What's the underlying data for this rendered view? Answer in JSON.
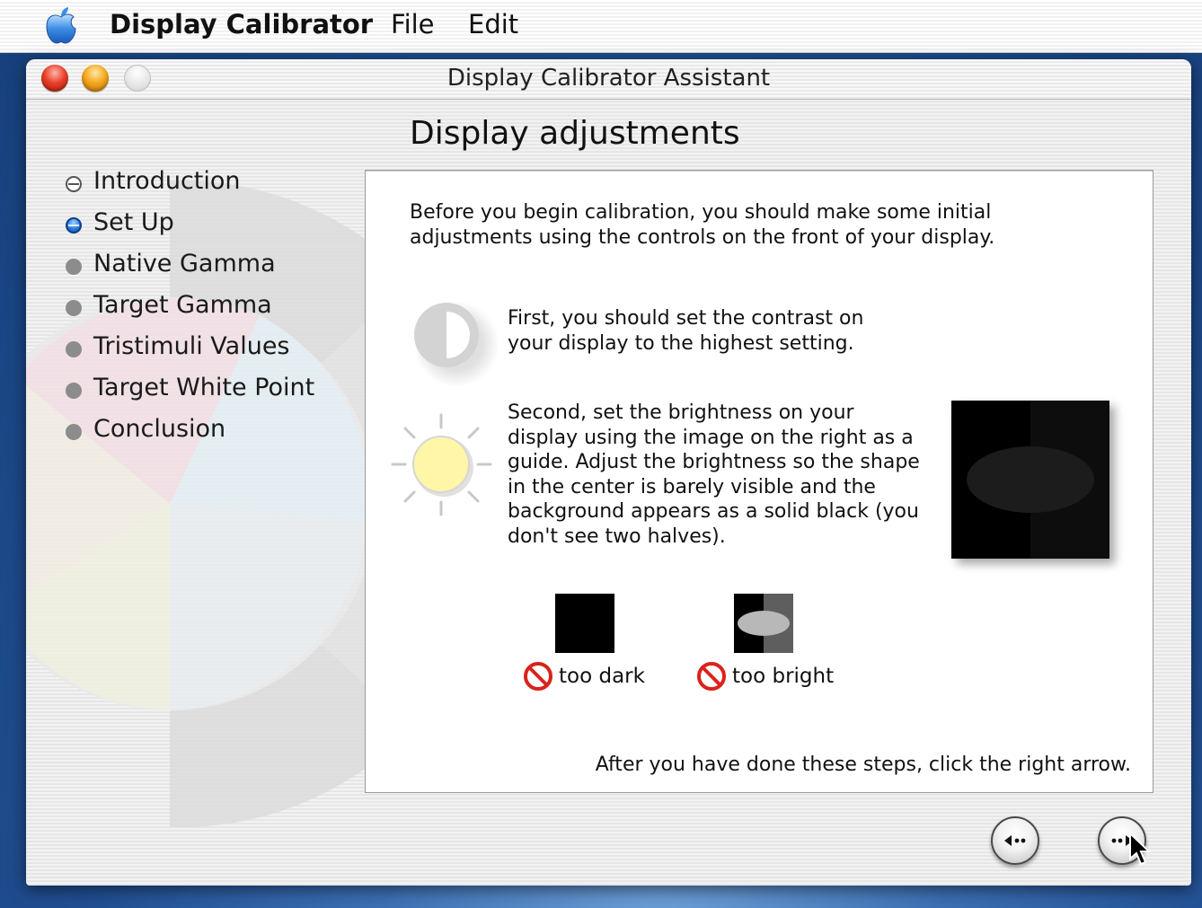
{
  "menubar": {
    "app_name": "Display Calibrator",
    "items": [
      "File",
      "Edit"
    ]
  },
  "window": {
    "title": "Display Calibrator Assistant",
    "step_title": "Display adjustments"
  },
  "steps": [
    {
      "label": "Introduction",
      "state": "done"
    },
    {
      "label": "Set Up",
      "state": "current"
    },
    {
      "label": "Native Gamma",
      "state": "pending"
    },
    {
      "label": "Target Gamma",
      "state": "pending"
    },
    {
      "label": "Tristimuli Values",
      "state": "pending"
    },
    {
      "label": "Target White Point",
      "state": "pending"
    },
    {
      "label": "Conclusion",
      "state": "pending"
    }
  ],
  "content": {
    "intro": "Before you begin calibration, you should make some initial adjustments using the controls on the front of your display.",
    "contrast_text": "First, you should set the contrast on your display to the highest setting.",
    "brightness_text": "Second, set the brightness on your display using the image on the right as a guide.  Adjust the brightness so the shape in the center is barely visible and the background appears as a solid black (you don't see two halves).",
    "too_dark_label": "too dark",
    "too_bright_label": "too bright",
    "footer": "After you have done these steps, click the right arrow."
  },
  "icons": {
    "apple": "apple-logo",
    "contrast": "contrast-icon",
    "brightness": "sun-icon",
    "not_allowed": "prohibited-icon",
    "back": "back-arrow-icon",
    "next": "next-arrow-icon"
  },
  "colors": {
    "current_step": "#2c7fe0",
    "prohibited": "#d9231b",
    "sun": "#fff6a8"
  }
}
